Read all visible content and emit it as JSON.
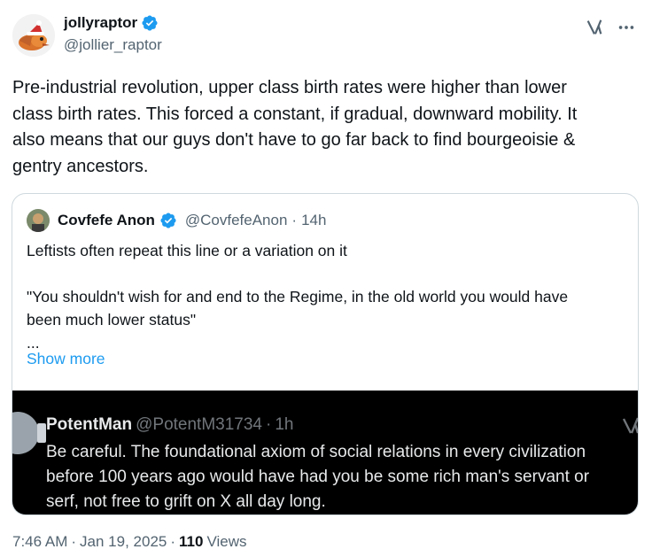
{
  "author": {
    "display_name": "jollyraptor",
    "handle": "@jollier_raptor"
  },
  "icons": {
    "verified": "verified-badge-icon",
    "grok": "grok-icon",
    "more": "more-options-icon"
  },
  "colors": {
    "accent": "#1d9bf0",
    "secondary_text": "#536471",
    "border": "#cfd9de"
  },
  "tweet": {
    "text_lines": [
      "Pre-industrial revolution, upper class birth rates were higher than lower",
      "class birth rates. This forced a constant, if gradual, downward mobility. It",
      "also means that our guys don't have to go far back to find bourgeoisie &",
      "gentry ancestors."
    ]
  },
  "quote": {
    "display_name": "Covfefe Anon",
    "handle": "@CovfefeAnon",
    "dot": "·",
    "time": "14h",
    "lines": [
      "Leftists often repeat this line or a variation on it",
      "",
      "\"You shouldn't wish for and end to the Regime, in the old world you would have",
      "been much lower status\"",
      "..."
    ],
    "show_more": "Show more",
    "embedded": {
      "display_name": "PotentMan",
      "handle": "@PotentM31734",
      "dot": "·",
      "time": "1h",
      "lines": [
        "Be careful. The foundational axiom of social relations in every civilization",
        "before 100 years ago would have had you be some rich man's servant or",
        "serf, not free to grift on X all day long."
      ]
    }
  },
  "footer": {
    "time": "7:46 AM",
    "sep1": "·",
    "date": "Jan 19, 2025",
    "sep2": "·",
    "views_count": "110",
    "views_label": "Views"
  }
}
